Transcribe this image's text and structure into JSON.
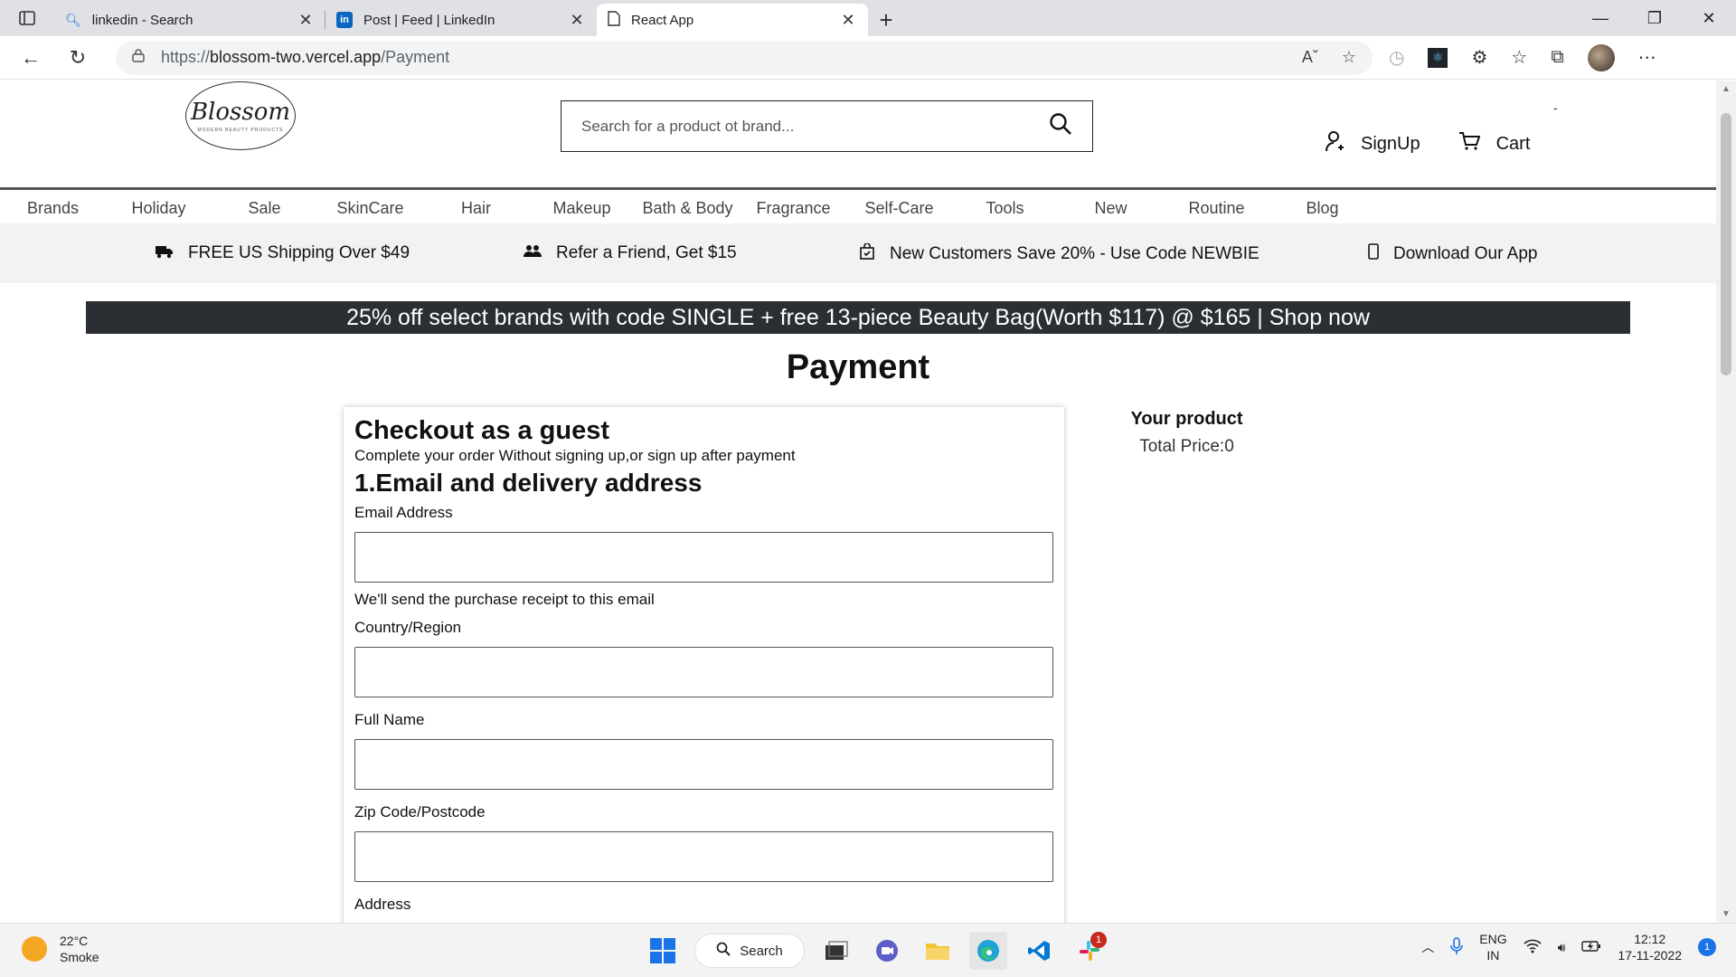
{
  "browser": {
    "tabs": [
      {
        "title": "linkedin - Search",
        "icon": "search-icon",
        "active": false
      },
      {
        "title": "Post | Feed | LinkedIn",
        "icon": "linkedin-icon",
        "active": false
      },
      {
        "title": "React App",
        "icon": "page-icon",
        "active": true
      }
    ],
    "new_tab": "+",
    "url_prefix": "https://",
    "url_host": "blossom-two.vercel.app",
    "url_path": "/Payment"
  },
  "header": {
    "logo_text": "Blossom",
    "logo_sub": "MODERN BEAUTY PRODUCTS",
    "search_placeholder": "Search for a product ot brand...",
    "signup": "SignUp",
    "cart": "Cart",
    "dash": "-"
  },
  "categories": [
    "Brands",
    "Holiday",
    "Sale",
    "SkinCare",
    "Hair",
    "Makeup",
    "Bath & Body",
    "Fragrance",
    "Self-Care",
    "Tools",
    "New",
    "Routine",
    "Blog"
  ],
  "perks": [
    {
      "icon": "truck-icon",
      "text": "FREE US Shipping Over $49"
    },
    {
      "icon": "users-icon",
      "text": "Refer a Friend, Get $15"
    },
    {
      "icon": "bag-icon",
      "text": "New Customers Save 20% - Use Code NEWBIE"
    },
    {
      "icon": "phone-icon",
      "text": "Download Our App"
    }
  ],
  "promo": "25% off select brands with code SINGLE + free 13-piece Beauty Bag(Worth $117) @ $165 | Shop now",
  "page_title": "Payment",
  "checkout": {
    "title": "Checkout as a guest",
    "subtitle": "Complete your order Without signing up,or sign up after payment",
    "section": "1.Email and delivery address",
    "email_label": "Email Address",
    "email_hint": "We'll send the purchase receipt to this email",
    "country_label": "Country/Region",
    "name_label": "Full Name",
    "zip_label": "Zip Code/Postcode",
    "address_label": "Address"
  },
  "summary": {
    "title": "Your product",
    "total": "Total Price:0"
  },
  "taskbar": {
    "temp": "22°C",
    "weather": "Smoke",
    "search": "Search",
    "badge": "1",
    "lang1": "ENG",
    "lang2": "IN",
    "time": "12:12",
    "date": "17-11-2022",
    "notif": "1"
  }
}
